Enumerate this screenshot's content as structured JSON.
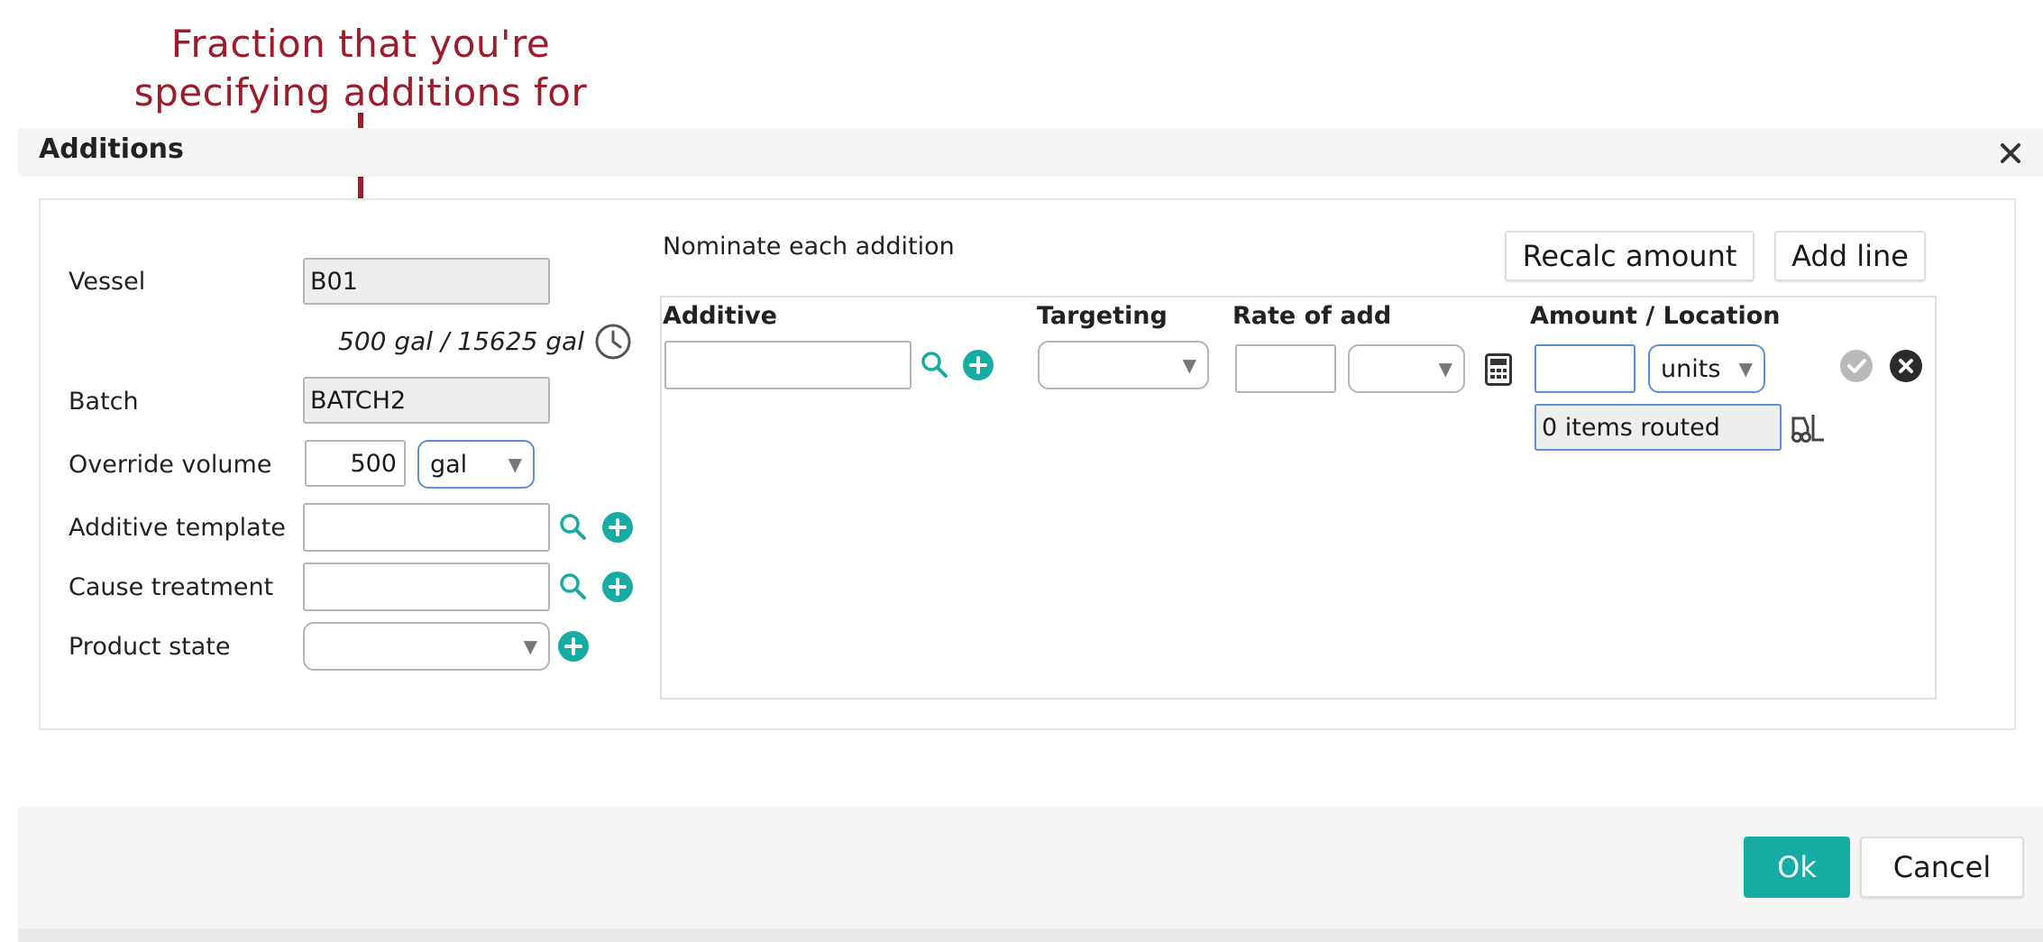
{
  "annotation": {
    "line1": "Fraction that you're",
    "line2": "specifying additions for",
    "color": "#9b1c2a"
  },
  "dialog": {
    "title": "Additions",
    "close_icon": "close-icon"
  },
  "left_form": {
    "vessel": {
      "label": "Vessel",
      "value": "B01"
    },
    "volume_text": "500 gal / 15625 gal",
    "history_icon": "clock-icon",
    "batch": {
      "label": "Batch",
      "value": "BATCH2"
    },
    "override_volume": {
      "label": "Override volume",
      "value": "500",
      "unit": "gal"
    },
    "additive_template": {
      "label": "Additive template",
      "value": ""
    },
    "cause_treatment": {
      "label": "Cause treatment",
      "value": ""
    },
    "product_state": {
      "label": "Product state",
      "value": ""
    }
  },
  "nominate": {
    "label": "Nominate each addition",
    "recalc_label": "Recalc amount",
    "add_line_label": "Add line"
  },
  "grid": {
    "columns": [
      "Additive",
      "Targeting",
      "Rate of add",
      "Amount / Location"
    ],
    "row": {
      "additive": "",
      "targeting": "",
      "rate": "",
      "rate_unit": "",
      "amount": "",
      "amount_unit": "units",
      "routed": "0 items routed"
    }
  },
  "footer": {
    "ok_label": "Ok",
    "cancel_label": "Cancel"
  },
  "colors": {
    "accent": "#17aca3",
    "annotation": "#9b1c2a",
    "select_border_blue": "#5b8fd6"
  }
}
